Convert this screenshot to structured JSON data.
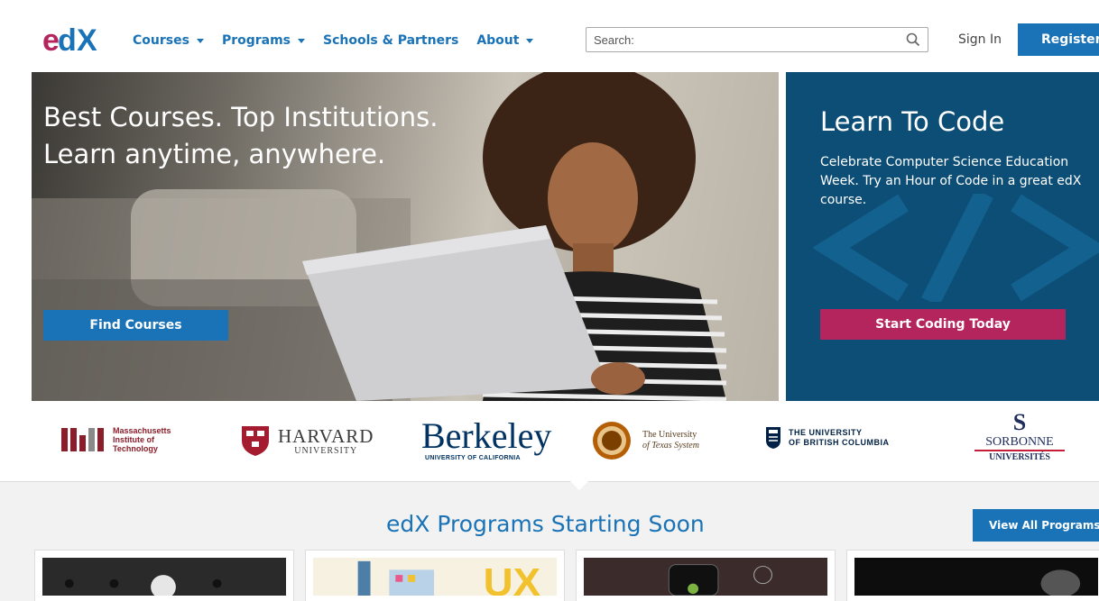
{
  "header": {
    "logo_text": "edX",
    "nav": [
      {
        "label": "Courses",
        "has_caret": true
      },
      {
        "label": "Programs",
        "has_caret": true
      },
      {
        "label": "Schools & Partners",
        "has_caret": false
      },
      {
        "label": "About",
        "has_caret": true
      }
    ],
    "search_placeholder": "Search:",
    "sign_in": "Sign In",
    "register": "Register"
  },
  "hero": {
    "title_line1": "Best Courses. Top Institutions.",
    "title_line2": "Learn anytime, anywhere.",
    "button": "Find Courses"
  },
  "code_panel": {
    "title": "Learn To Code",
    "description": "Celebrate Computer Science Education Week. Try an Hour of Code in a great edX course.",
    "button": "Start Coding Today",
    "glyph": "</>"
  },
  "partners": {
    "mit": "Massachusetts Institute of Technology",
    "harvard_main": "HARVARD",
    "harvard_sub": "UNIVERSITY",
    "berkeley_main": "Berkeley",
    "berkeley_sub": "UNIVERSITY OF CALIFORNIA",
    "texas_line1": "The University",
    "texas_line2": "of Texas System",
    "ubc_line1": "THE UNIVERSITY",
    "ubc_line2": "OF BRITISH COLUMBIA",
    "sorbonne_s": "S",
    "sorbonne_name": "SORBONNE",
    "sorbonne_sub": "UNIVERSITÉS"
  },
  "programs": {
    "title": "edX Programs Starting Soon",
    "view_all": "View All Programs"
  },
  "colors": {
    "brand_blue": "#1a73b6",
    "code_panel_bg": "#0d4e77",
    "code_button": "#b5255d",
    "programs_bg": "#f2f2f2"
  }
}
